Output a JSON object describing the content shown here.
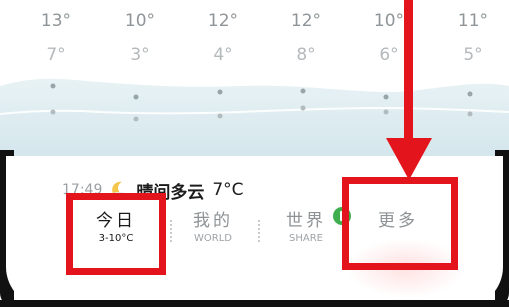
{
  "forecast": {
    "highs": [
      "13°",
      "10°",
      "12°",
      "12°",
      "10°",
      "11°"
    ],
    "lows": [
      "7°",
      "3°",
      "4°",
      "8°",
      "6°",
      "5°"
    ]
  },
  "current": {
    "time": "17:49",
    "icon": "moon-icon",
    "condition": "晴间多云",
    "temperature": "7°C"
  },
  "tabs": [
    {
      "label": "今日",
      "sub": "3-10°C",
      "active": true
    },
    {
      "label": "我的",
      "sub": "WORLD",
      "active": false
    },
    {
      "label": "世界",
      "sub": "SHARE",
      "active": false,
      "badge": true
    },
    {
      "label": "更多",
      "sub": "",
      "active": false
    }
  ],
  "colors": {
    "annotation": "#e3141b",
    "badge": "#3fae4f",
    "wave": "#d6e8ee"
  }
}
